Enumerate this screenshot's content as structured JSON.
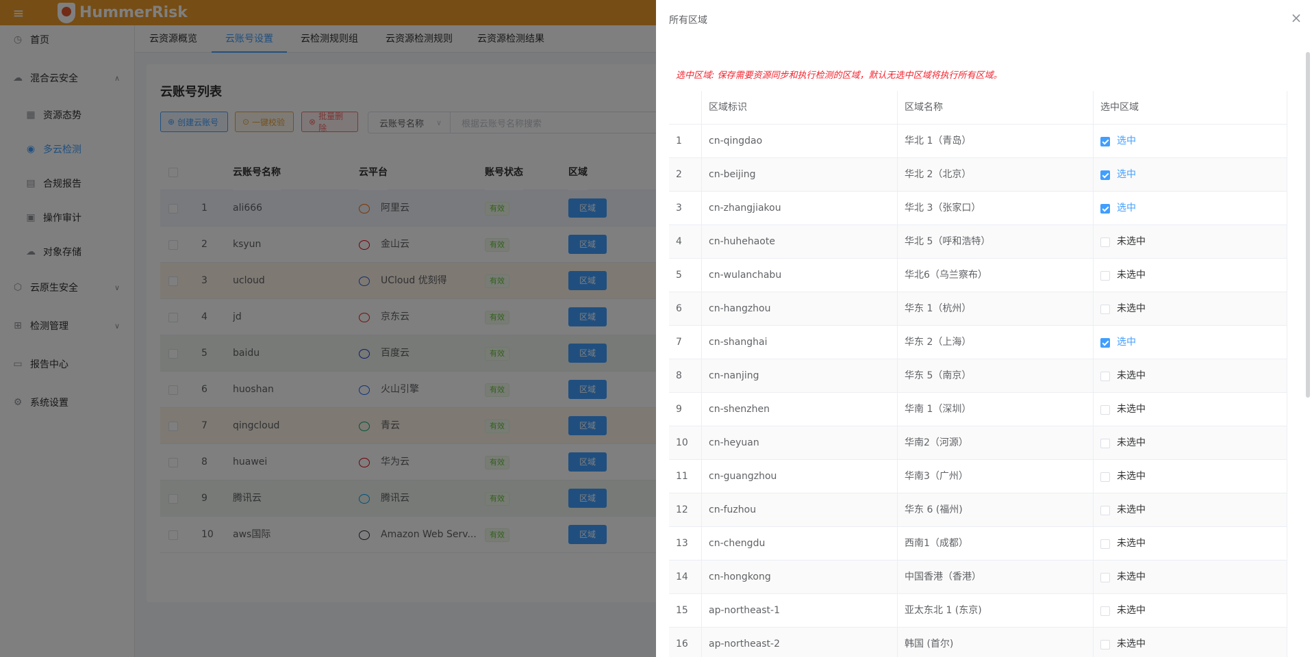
{
  "app": {
    "logo_text": "HummerRisk"
  },
  "sidebar": {
    "items": [
      {
        "label": "首页",
        "icon": "clock-icon"
      },
      {
        "label": "混合云安全",
        "icon": "cloud-icon"
      },
      {
        "label": "资源态势",
        "icon": "chart-icon"
      },
      {
        "label": "多云检测",
        "icon": "eye-icon"
      },
      {
        "label": "合规报告",
        "icon": "document-icon"
      },
      {
        "label": "操作审计",
        "icon": "audit-icon"
      },
      {
        "label": "对象存储",
        "icon": "storage-icon"
      },
      {
        "label": "云原生安全",
        "icon": "cloud-native-icon"
      },
      {
        "label": "检测管理",
        "icon": "grid-icon"
      },
      {
        "label": "报告中心",
        "icon": "report-icon"
      },
      {
        "label": "系统设置",
        "icon": "gear-icon"
      }
    ]
  },
  "tabs": [
    "云资源概览",
    "云账号设置",
    "云检测规则组",
    "云资源检测规则",
    "云资源检测结果"
  ],
  "page": {
    "title": "云账号列表",
    "create_btn": "创建云账号",
    "verify_btn": "一键校验",
    "delete_btn": "批量删除",
    "filter_select": "云账号名称",
    "search_placeholder": "根据云账号名称搜索"
  },
  "accounts": {
    "headers": [
      "云账号名称",
      "云平台",
      "账号状态",
      "区域"
    ],
    "status_label": "有效",
    "region_btn": "区域",
    "rows": [
      {
        "no": "1",
        "name": "ali666",
        "platform": "阿里云",
        "color": "#ff6a00"
      },
      {
        "no": "2",
        "name": "ksyun",
        "platform": "金山云",
        "color": "#e60012"
      },
      {
        "no": "3",
        "name": "ucloud",
        "platform": "UCloud 优刻得",
        "color": "#2a5bd7"
      },
      {
        "no": "4",
        "name": "jd",
        "platform": "京东云",
        "color": "#e2231a"
      },
      {
        "no": "5",
        "name": "baidu",
        "platform": "百度云",
        "color": "#2932e1"
      },
      {
        "no": "6",
        "name": "huoshan",
        "platform": "火山引擎",
        "color": "#1664ff"
      },
      {
        "no": "7",
        "name": "qingcloud",
        "platform": "青云",
        "color": "#00a971"
      },
      {
        "no": "8",
        "name": "huawei",
        "platform": "华为云",
        "color": "#e60012"
      },
      {
        "no": "9",
        "name": "腾讯云",
        "platform": "腾讯云",
        "color": "#00a3ff"
      },
      {
        "no": "10",
        "name": "aws国际",
        "platform": "Amazon Web Serv...",
        "color": "#232f3e"
      }
    ]
  },
  "drawer": {
    "title": "所有区域",
    "note": "选中区域: 保存需要资源同步和执行检测的区域，默认无选中区域将执行所有区域。",
    "headers": [
      "区域标识",
      "区域名称",
      "选中区域"
    ],
    "checked_label": "选中",
    "unchecked_label": "未选中",
    "rows": [
      {
        "no": "1",
        "id": "cn-qingdao",
        "name": "华北 1（青岛）",
        "checked": true
      },
      {
        "no": "2",
        "id": "cn-beijing",
        "name": "华北 2（北京）",
        "checked": true
      },
      {
        "no": "3",
        "id": "cn-zhangjiakou",
        "name": "华北 3（张家口）",
        "checked": true
      },
      {
        "no": "4",
        "id": "cn-huhehaote",
        "name": "华北 5（呼和浩特）",
        "checked": false
      },
      {
        "no": "5",
        "id": "cn-wulanchabu",
        "name": "华北6（乌兰察布）",
        "checked": false
      },
      {
        "no": "6",
        "id": "cn-hangzhou",
        "name": "华东 1（杭州）",
        "checked": false
      },
      {
        "no": "7",
        "id": "cn-shanghai",
        "name": "华东 2（上海）",
        "checked": true
      },
      {
        "no": "8",
        "id": "cn-nanjing",
        "name": "华东 5（南京）",
        "checked": false
      },
      {
        "no": "9",
        "id": "cn-shenzhen",
        "name": "华南 1（深圳）",
        "checked": false
      },
      {
        "no": "10",
        "id": "cn-heyuan",
        "name": "华南2（河源）",
        "checked": false
      },
      {
        "no": "11",
        "id": "cn-guangzhou",
        "name": "华南3（广州）",
        "checked": false
      },
      {
        "no": "12",
        "id": "cn-fuzhou",
        "name": "华东 6 (福州)",
        "checked": false
      },
      {
        "no": "13",
        "id": "cn-chengdu",
        "name": "西南1（成都）",
        "checked": false
      },
      {
        "no": "14",
        "id": "cn-hongkong",
        "name": "中国香港（香港）",
        "checked": false
      },
      {
        "no": "15",
        "id": "ap-northeast-1",
        "name": "亚太东北 1 (东京)",
        "checked": false
      },
      {
        "no": "16",
        "id": "ap-northeast-2",
        "name": "韩国 (首尔)",
        "checked": false
      }
    ]
  }
}
